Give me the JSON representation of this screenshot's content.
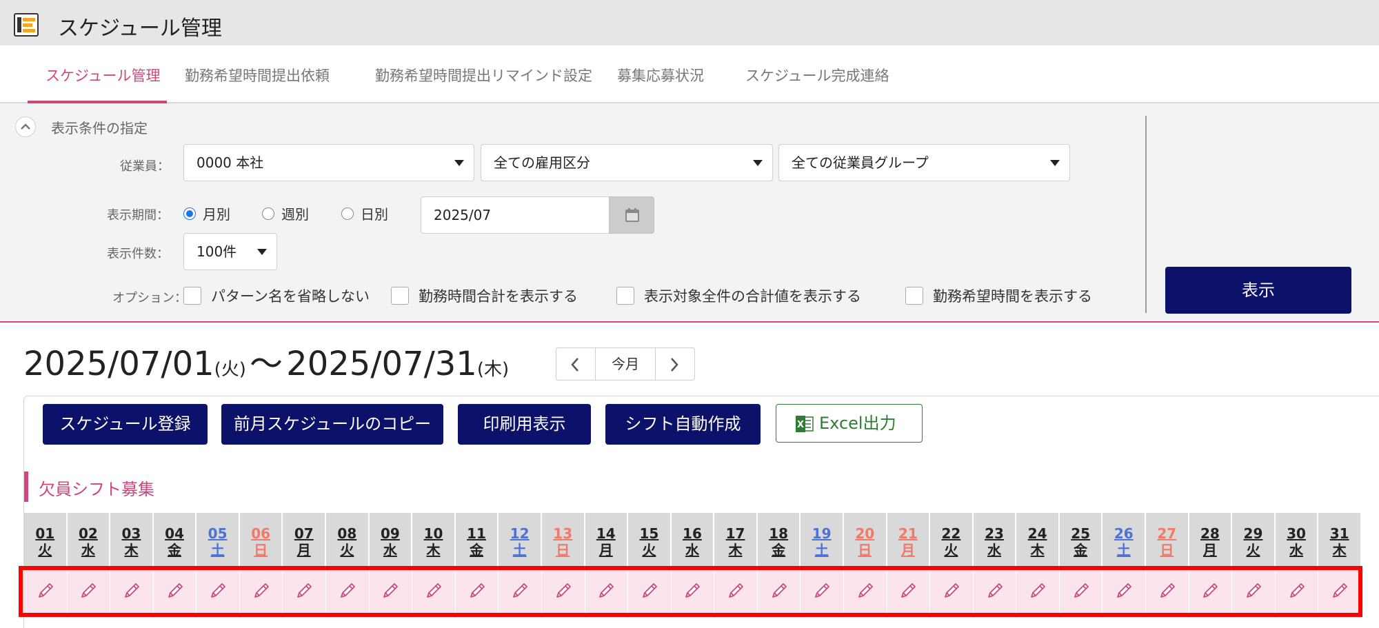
{
  "app": {
    "title": "スケジュール管理",
    "icon": "schedule-app-icon"
  },
  "tabs": [
    {
      "label": "スケジュール管理",
      "active": true
    },
    {
      "label": "勤務希望時間提出依頼",
      "active": false
    },
    {
      "label": "勤務希望時間提出リマインド設定",
      "active": false
    },
    {
      "label": "募集応募状況",
      "active": false
    },
    {
      "label": "スケジュール完成連絡",
      "active": false
    }
  ],
  "filter": {
    "title": "表示条件の指定",
    "employee_label": "従業員：",
    "employee_value": "0000 本社",
    "employment_type_value": "全ての雇用区分",
    "employee_group_value": "全ての従業員グループ",
    "period_label": "表示期間：",
    "period_options": [
      {
        "label": "月別",
        "checked": true
      },
      {
        "label": "週別",
        "checked": false
      },
      {
        "label": "日別",
        "checked": false
      }
    ],
    "date_value": "2025/07",
    "count_label": "表示件数：",
    "count_value": "100件",
    "options_label": "オプション：",
    "options": [
      {
        "label": "パターン名を省略しない",
        "checked": false
      },
      {
        "label": "勤務時間合計を表示する",
        "checked": false
      },
      {
        "label": "表示対象全件の合計値を表示する",
        "checked": false
      },
      {
        "label": "勤務希望時間を表示する",
        "checked": false
      }
    ],
    "show_button": "表示"
  },
  "range": {
    "start": "2025/07/01",
    "start_dow": "(火)",
    "separator": "〜",
    "end": "2025/07/31",
    "end_dow": "(木)"
  },
  "nav": {
    "today": "今月"
  },
  "actions": {
    "register": "スケジュール登録",
    "copy_prev": "前月スケジュールのコピー",
    "print": "印刷用表示",
    "auto_shift": "シフト自動作成",
    "excel": "Excel出力"
  },
  "section": {
    "title": "欠員シフト募集"
  },
  "days": [
    {
      "d": "01",
      "w": "火",
      "type": "weekday"
    },
    {
      "d": "02",
      "w": "水",
      "type": "weekday"
    },
    {
      "d": "03",
      "w": "木",
      "type": "weekday"
    },
    {
      "d": "04",
      "w": "金",
      "type": "weekday"
    },
    {
      "d": "05",
      "w": "土",
      "type": "sat"
    },
    {
      "d": "06",
      "w": "日",
      "type": "sun"
    },
    {
      "d": "07",
      "w": "月",
      "type": "weekday"
    },
    {
      "d": "08",
      "w": "火",
      "type": "weekday"
    },
    {
      "d": "09",
      "w": "水",
      "type": "weekday"
    },
    {
      "d": "10",
      "w": "木",
      "type": "weekday"
    },
    {
      "d": "11",
      "w": "金",
      "type": "weekday"
    },
    {
      "d": "12",
      "w": "土",
      "type": "sat"
    },
    {
      "d": "13",
      "w": "日",
      "type": "sun"
    },
    {
      "d": "14",
      "w": "月",
      "type": "weekday"
    },
    {
      "d": "15",
      "w": "火",
      "type": "weekday"
    },
    {
      "d": "16",
      "w": "水",
      "type": "weekday"
    },
    {
      "d": "17",
      "w": "木",
      "type": "weekday"
    },
    {
      "d": "18",
      "w": "金",
      "type": "weekday"
    },
    {
      "d": "19",
      "w": "土",
      "type": "sat"
    },
    {
      "d": "20",
      "w": "日",
      "type": "sun"
    },
    {
      "d": "21",
      "w": "月",
      "type": "sun"
    },
    {
      "d": "22",
      "w": "火",
      "type": "weekday"
    },
    {
      "d": "23",
      "w": "水",
      "type": "weekday"
    },
    {
      "d": "24",
      "w": "木",
      "type": "weekday"
    },
    {
      "d": "25",
      "w": "金",
      "type": "weekday"
    },
    {
      "d": "26",
      "w": "土",
      "type": "sat"
    },
    {
      "d": "27",
      "w": "日",
      "type": "sun"
    },
    {
      "d": "28",
      "w": "月",
      "type": "weekday"
    },
    {
      "d": "29",
      "w": "火",
      "type": "weekday"
    },
    {
      "d": "30",
      "w": "水",
      "type": "weekday"
    },
    {
      "d": "31",
      "w": "木",
      "type": "weekday"
    }
  ],
  "colors": {
    "accent": "#d0467c",
    "primary_button": "#0c1169",
    "saturday": "#4d72d4",
    "sunday_holiday": "#f07a6a",
    "recruit_cell": "#fce4ec",
    "highlight": "#ff0000"
  }
}
